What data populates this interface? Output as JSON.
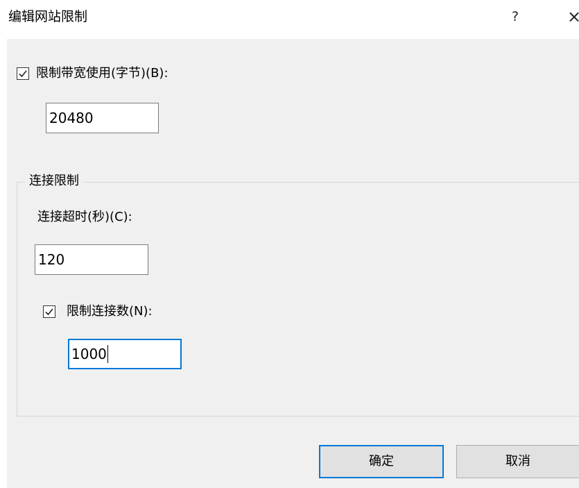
{
  "dialog": {
    "title": "编辑网站限制",
    "help_glyph": "?",
    "close_glyph": "×"
  },
  "bandwidth": {
    "checked": true,
    "label": "限制带宽使用(字节)(B):",
    "value": "20480"
  },
  "connection_group": {
    "legend": "连接限制",
    "timeout_label": "连接超时(秒)(C):",
    "timeout_value": "120",
    "limit_connections": {
      "checked": true,
      "label": "限制连接数(N):",
      "value": "1000"
    }
  },
  "buttons": {
    "ok": "确定",
    "cancel": "取消"
  },
  "colors": {
    "focus": "#0078d7",
    "panel": "#f0f0f0"
  }
}
